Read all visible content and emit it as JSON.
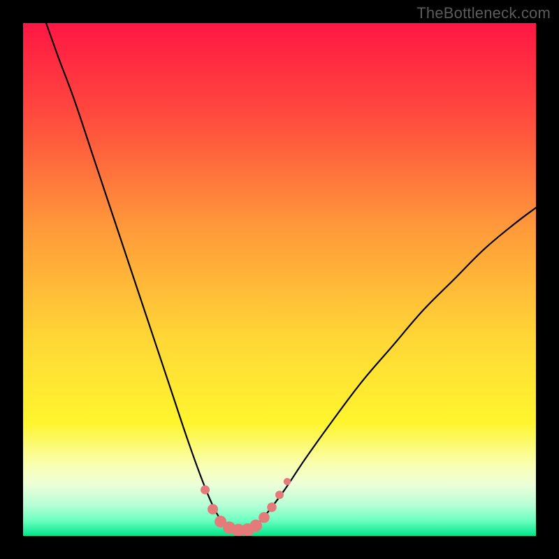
{
  "watermark": "TheBottleneck.com",
  "colors": {
    "page_bg": "#000000",
    "curve": "#000000",
    "marker": "#e47a7a",
    "watermark": "#5c5c5c",
    "gradient_stops": [
      {
        "offset": "0%",
        "color": "#ff1744"
      },
      {
        "offset": "18%",
        "color": "#ff4a3e"
      },
      {
        "offset": "40%",
        "color": "#ff9a3a"
      },
      {
        "offset": "62%",
        "color": "#ffd836"
      },
      {
        "offset": "78%",
        "color": "#fff52e"
      },
      {
        "offset": "86%",
        "color": "#faffb0"
      },
      {
        "offset": "90%",
        "color": "#ecffd8"
      },
      {
        "offset": "94%",
        "color": "#b6ffd6"
      },
      {
        "offset": "97%",
        "color": "#6bffc0"
      },
      {
        "offset": "100%",
        "color": "#00e58a"
      }
    ]
  },
  "chart_data": {
    "type": "line",
    "title": "",
    "xlabel": "",
    "ylabel": "",
    "xlim": [
      0,
      100
    ],
    "ylim": [
      0,
      100
    ],
    "curve_points": [
      {
        "x": 4.5,
        "y": 100
      },
      {
        "x": 7,
        "y": 93
      },
      {
        "x": 10,
        "y": 85
      },
      {
        "x": 14,
        "y": 73
      },
      {
        "x": 18,
        "y": 61
      },
      {
        "x": 22,
        "y": 49
      },
      {
        "x": 26,
        "y": 37
      },
      {
        "x": 29,
        "y": 28
      },
      {
        "x": 32,
        "y": 19
      },
      {
        "x": 34.5,
        "y": 12
      },
      {
        "x": 36.5,
        "y": 7
      },
      {
        "x": 38,
        "y": 4
      },
      {
        "x": 39.5,
        "y": 2.2
      },
      {
        "x": 41,
        "y": 1.3
      },
      {
        "x": 42.5,
        "y": 1.0
      },
      {
        "x": 44,
        "y": 1.3
      },
      {
        "x": 46,
        "y": 2.6
      },
      {
        "x": 48,
        "y": 5
      },
      {
        "x": 51,
        "y": 9
      },
      {
        "x": 55,
        "y": 15
      },
      {
        "x": 60,
        "y": 22
      },
      {
        "x": 66,
        "y": 30
      },
      {
        "x": 72,
        "y": 37
      },
      {
        "x": 78,
        "y": 44
      },
      {
        "x": 84,
        "y": 50
      },
      {
        "x": 90,
        "y": 56
      },
      {
        "x": 96,
        "y": 61
      },
      {
        "x": 100,
        "y": 64
      }
    ],
    "markers": [
      {
        "x": 35.5,
        "y": 9,
        "r": 6.5
      },
      {
        "x": 37.0,
        "y": 5.2,
        "r": 7.5
      },
      {
        "x": 38.5,
        "y": 2.8,
        "r": 8.5
      },
      {
        "x": 40.2,
        "y": 1.6,
        "r": 9.0
      },
      {
        "x": 42.0,
        "y": 1.1,
        "r": 9.2
      },
      {
        "x": 43.8,
        "y": 1.2,
        "r": 9.2
      },
      {
        "x": 45.4,
        "y": 2.0,
        "r": 8.8
      },
      {
        "x": 47.0,
        "y": 3.6,
        "r": 7.8
      },
      {
        "x": 48.5,
        "y": 5.6,
        "r": 6.8
      },
      {
        "x": 50.0,
        "y": 8.0,
        "r": 6.0
      },
      {
        "x": 51.5,
        "y": 10.6,
        "r": 5.2
      }
    ]
  }
}
